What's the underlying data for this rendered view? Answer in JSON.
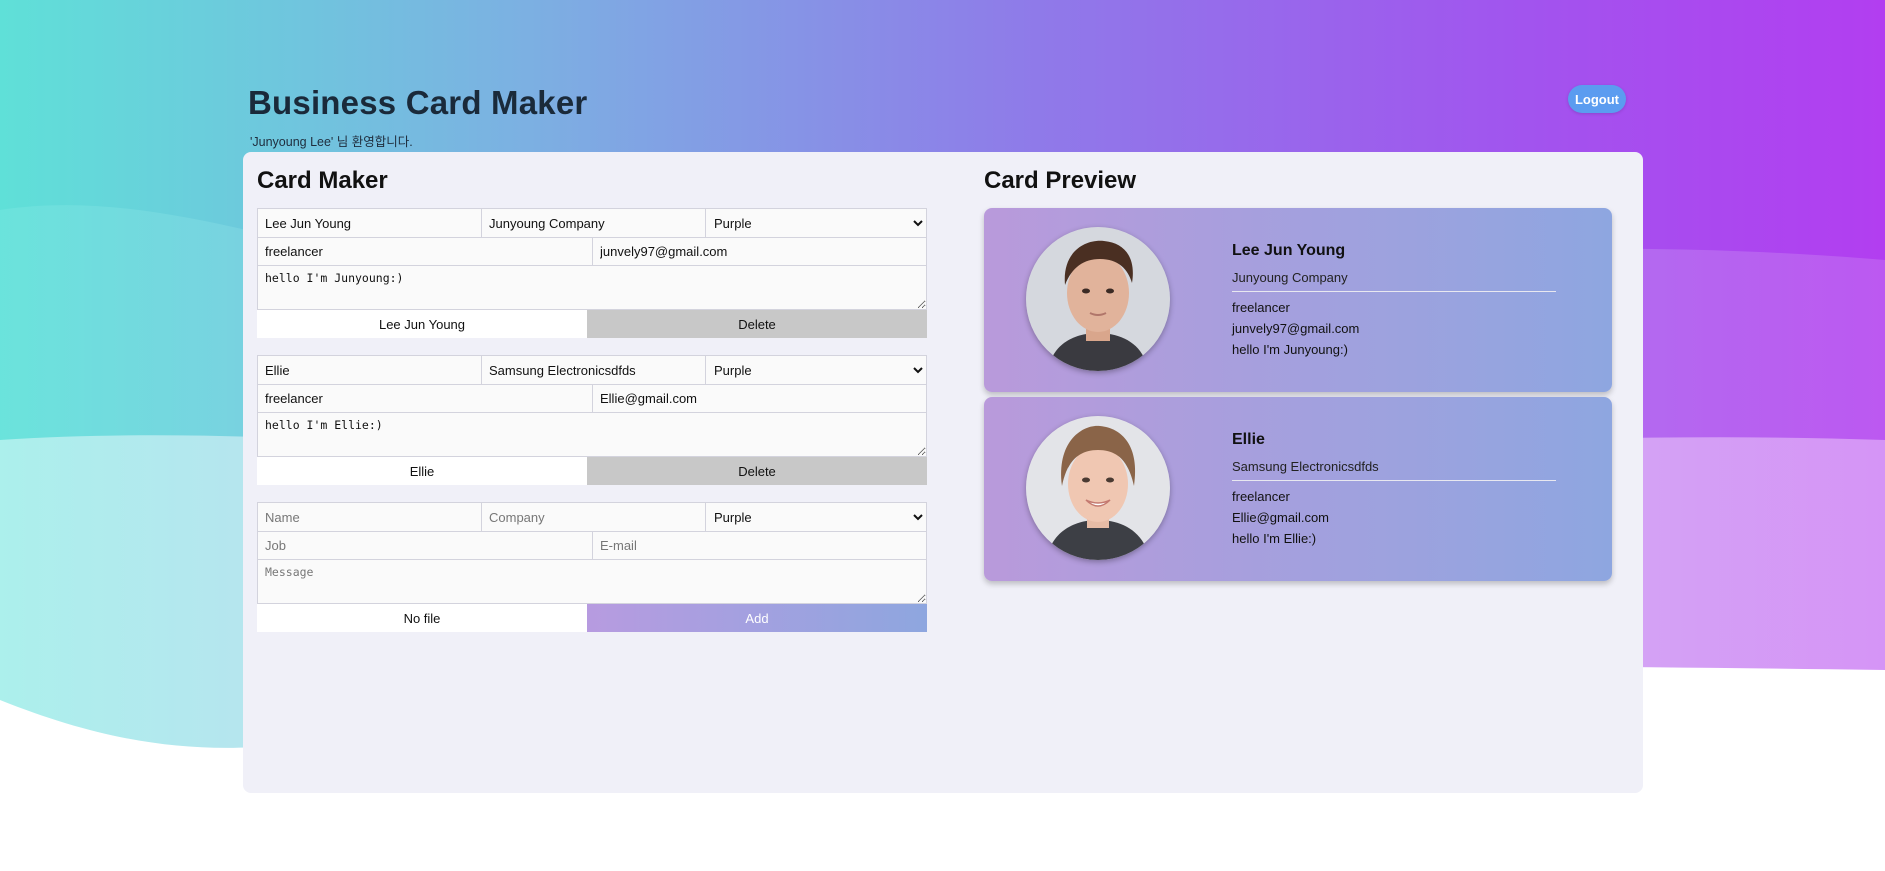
{
  "header": {
    "title": "Business Card Maker",
    "welcome": "'Junyoung Lee' 님 환영합니다.",
    "logout_label": "Logout"
  },
  "maker": {
    "title": "Card Maker",
    "cards": [
      {
        "name": "Lee Jun Young",
        "company": "Junyoung Company",
        "theme": "Purple",
        "job": "freelancer",
        "email": "junvely97@gmail.com",
        "message": "hello I'm Junyoung:)",
        "file_label": "Lee Jun Young",
        "delete_label": "Delete"
      },
      {
        "name": "Ellie",
        "company": "Samsung Electronicsdfds",
        "theme": "Purple",
        "job": "freelancer",
        "email": "Ellie@gmail.com",
        "message": "hello I'm Ellie:)",
        "file_label": "Ellie",
        "delete_label": "Delete"
      }
    ],
    "add_form": {
      "name_placeholder": "Name",
      "company_placeholder": "Company",
      "theme": "Purple",
      "job_placeholder": "Job",
      "email_placeholder": "E-mail",
      "message_placeholder": "Message",
      "file_label": "No file",
      "add_label": "Add"
    }
  },
  "preview": {
    "title": "Card Preview",
    "cards": [
      {
        "name": "Lee Jun Young",
        "company": "Junyoung Company",
        "job": "freelancer",
        "email": "junvely97@gmail.com",
        "message": "hello I'm Junyoung:)"
      },
      {
        "name": "Ellie",
        "company": "Samsung Electronicsdfds",
        "job": "freelancer",
        "email": "Ellie@gmail.com",
        "message": "hello I'm Ellie:)"
      }
    ]
  },
  "colors": {
    "card_theme_start": "#b99adb",
    "card_theme_end": "#8ea6e0",
    "logout_button": "#5b9cf0",
    "delete_button": "#c8c8c8"
  }
}
